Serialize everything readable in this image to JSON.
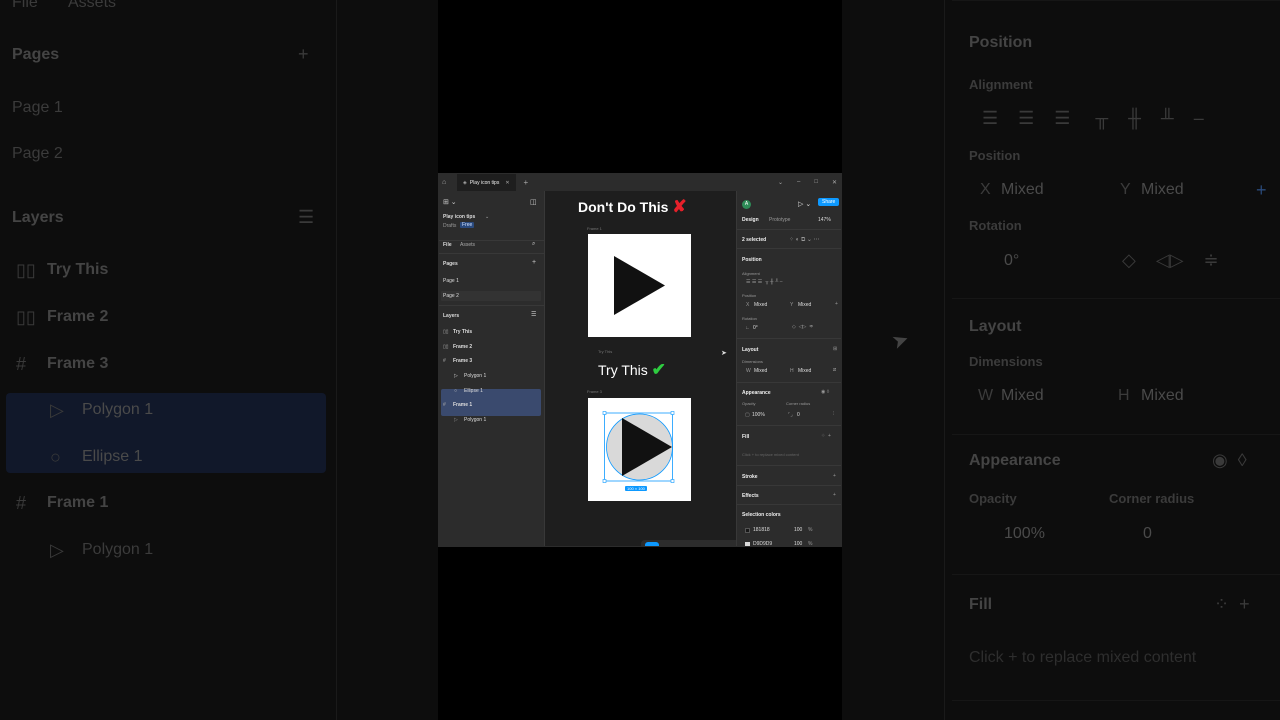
{
  "bg_left": {
    "file": "File",
    "assets": "Assets",
    "pages": "Pages",
    "page1": "Page 1",
    "page2": "Page 2",
    "layers": "Layers",
    "layer_items": [
      "Try This",
      "Frame 2",
      "Frame 3",
      "Polygon 1",
      "Ellipse 1",
      "Frame 1",
      "Polygon 1"
    ]
  },
  "bg_right": {
    "position": "Position",
    "alignment": "Alignment",
    "position2": "Position",
    "x_label": "X",
    "x_value": "Mixed",
    "y_label": "Y",
    "y_value": "Mixed",
    "rotation": "Rotation",
    "rotation_value": "0°",
    "layout": "Layout",
    "dimensions": "Dimensions",
    "w_label": "W",
    "w_value": "Mixed",
    "h_label": "H",
    "h_value": "Mixed",
    "appearance": "Appearance",
    "opacity": "Opacity",
    "opacity_value": "100%",
    "corner_radius": "Corner radius",
    "corner_value": "0",
    "fill": "Fill",
    "fill_hint": "Click + to replace mixed content"
  },
  "app": {
    "tab_title": "Play icon tips",
    "file_name": "Play icon tips",
    "drafts": "Drafts",
    "free_badge": "Free",
    "file_tab": "File",
    "assets_tab": "Assets",
    "pages_heading": "Pages",
    "page1": "Page 1",
    "page2": "Page 2",
    "layers_heading": "Layers",
    "layers": [
      "Try This",
      "Frame 2",
      "Frame 3",
      "Polygon 1",
      "Ellipse 1",
      "Frame 1",
      "Polygon 1"
    ],
    "canvas": {
      "dont_heading": "Don't Do This",
      "frame1_label": "Frame 1",
      "trythis_label": "Try This",
      "try_heading": "Try This",
      "frame3_label": "Frame 3",
      "size_badge": "100 × 100"
    },
    "right": {
      "avatar": "A",
      "share": "Share",
      "design_tab": "Design",
      "prototype_tab": "Prototype",
      "zoom": "147%",
      "selected": "2 selected",
      "position": "Position",
      "alignment": "Alignment",
      "position_sub": "Position",
      "x_label": "X",
      "x_value": "Mixed",
      "y_label": "Y",
      "y_value": "Mixed",
      "rotation": "Rotation",
      "rotation_value": "0°",
      "layout": "Layout",
      "dimensions": "Dimensions",
      "w_label": "W",
      "w_value": "Mixed",
      "h_label": "H",
      "h_value": "Mixed",
      "appearance": "Appearance",
      "opacity": "Opacity",
      "opacity_value": "100%",
      "corner_radius": "Corner radius",
      "corner_value": "0",
      "fill": "Fill",
      "fill_hint": "Click + to replace mixed content",
      "stroke": "Stroke",
      "effects": "Effects",
      "selection_colors": "Selection colors",
      "color1": "181818",
      "color1_pct": "100",
      "color2": "D9D9D9",
      "color2_pct": "100",
      "pct": "%"
    }
  },
  "colors": {
    "accent": "#0d99ff",
    "selection": "#3a4a6e",
    "check": "#2ecc40",
    "cross": "#e8202a"
  }
}
